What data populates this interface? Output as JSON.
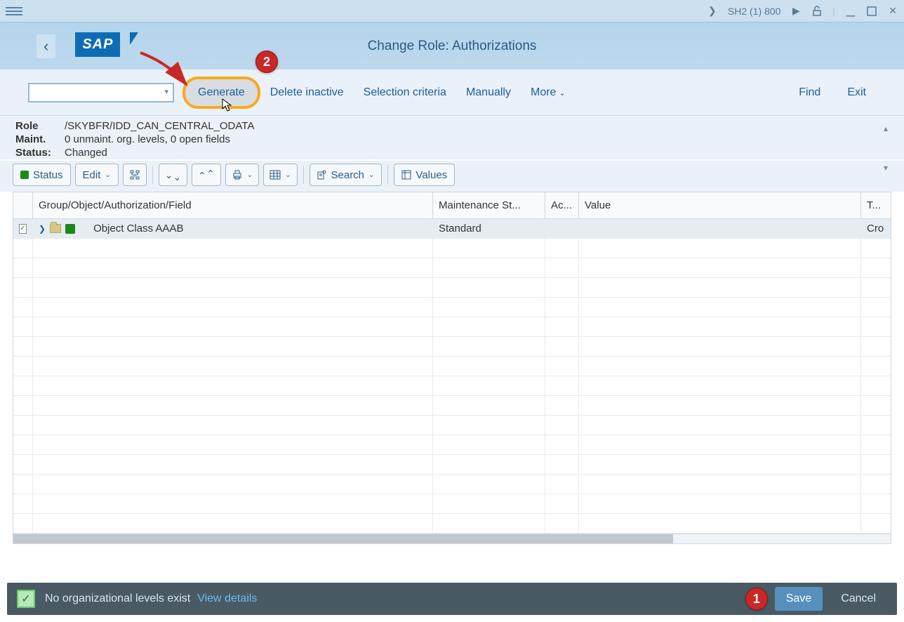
{
  "titlebar": {
    "system": "SH2 (1) 800"
  },
  "header": {
    "logo": "SAP",
    "title": "Change Role: Authorizations"
  },
  "toolbar": {
    "generate": "Generate",
    "delete_inactive": "Delete inactive",
    "selection_criteria": "Selection criteria",
    "manually": "Manually",
    "more": "More",
    "find": "Find",
    "exit": "Exit"
  },
  "info": {
    "role_label": "Role",
    "role_value": "/SKYBFR/IDD_CAN_CENTRAL_ODATA",
    "maint_label": "Maint.",
    "maint_value": "0 unmaint. org. levels, 0 open fields",
    "status_label": "Status:",
    "status_value": "Changed"
  },
  "btnbar": {
    "status": "Status",
    "edit": "Edit",
    "search": "Search",
    "values": "Values"
  },
  "grid": {
    "headers": {
      "group": "Group/Object/Authorization/Field",
      "maint": "Maintenance St...",
      "ac": "Ac...",
      "value": "Value",
      "t": "T..."
    },
    "rows": [
      {
        "label": "Object Class AAAB",
        "maint": "Standard",
        "t": "Cro"
      }
    ]
  },
  "statusbar": {
    "message": "No organizational levels exist",
    "link": "View details",
    "save": "Save",
    "cancel": "Cancel"
  },
  "annotations": {
    "badge1": "1",
    "badge2": "2"
  }
}
